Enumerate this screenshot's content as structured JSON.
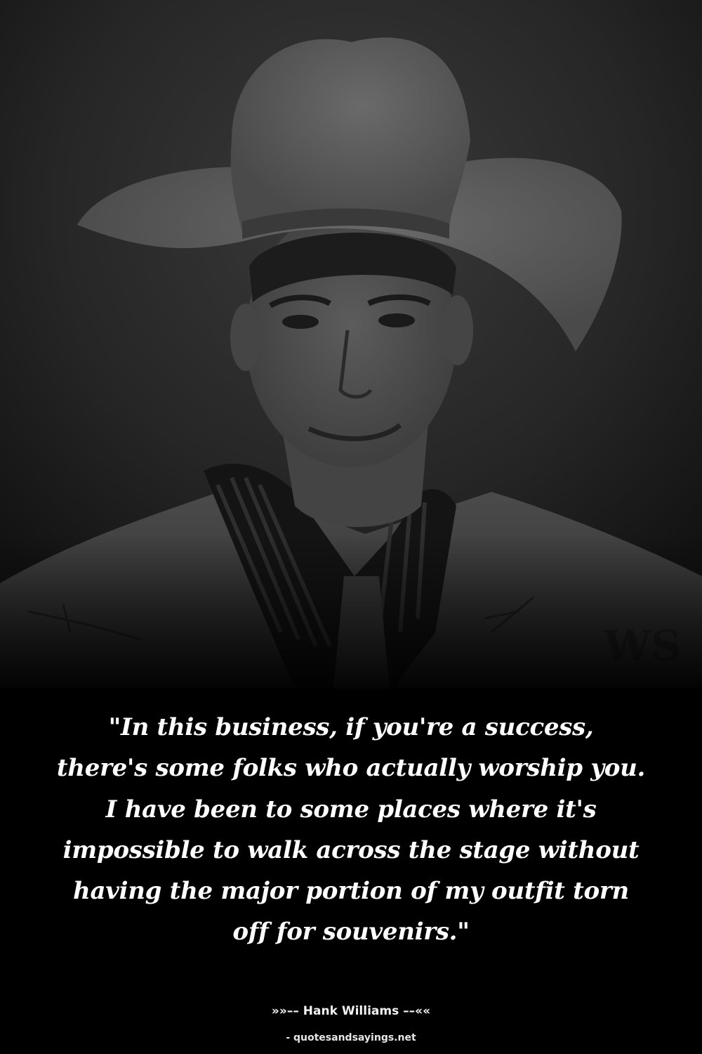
{
  "photo": {
    "subject": "portrait-of-man-in-white-cowboy-hat",
    "tone": "monochrome",
    "colors": {
      "background": "#000000",
      "hat": "#5a5a5a",
      "face": "#4a4a4a",
      "jacket": "#474747",
      "shirt": "#111111"
    }
  },
  "quote": {
    "lines": [
      "\"In this business, if you're a success,",
      "there's some folks who actually worship you.",
      "I have been to some places where it's",
      "impossible to walk across the stage without",
      "having the major portion of my outfit torn",
      "off for souvenirs.\""
    ]
  },
  "attribution": {
    "text": "»»–– Hank Williams ––««"
  },
  "source": {
    "text": "- quotesandsayings.net"
  }
}
